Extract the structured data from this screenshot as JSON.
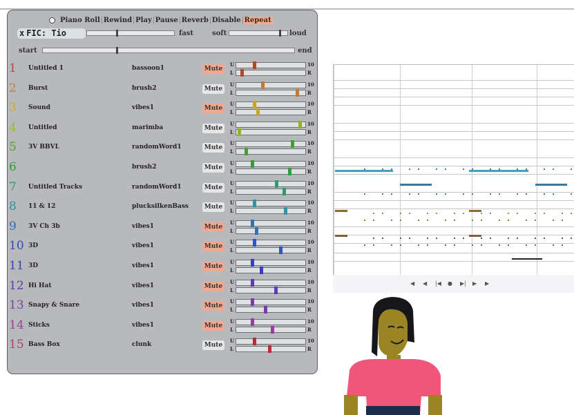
{
  "toolbar": {
    "items": [
      "Piano Roll",
      "Rewind",
      "Play",
      "Pause",
      "Reverb",
      "Disable",
      "Repeat"
    ]
  },
  "header": {
    "title_mark": "x",
    "title": "FIC: Tio",
    "fast_label": "fast",
    "soft_label": "soft",
    "loud_label": "loud",
    "start_label": "start",
    "end_label": "end"
  },
  "tracks": [
    {
      "num": "1",
      "num_color": "#b8482f",
      "name": "Untitled 1",
      "instrument": "bassoon1",
      "mute": "Mute",
      "mute_on": true,
      "volume": 0.25,
      "pan": 0.06,
      "color": "#b0472c"
    },
    {
      "num": "2",
      "num_color": "#c2813a",
      "name": "Burst",
      "instrument": "brush2",
      "mute": "Mute",
      "mute_on": false,
      "volume": 0.38,
      "pan": 0.9,
      "color": "#c6772d"
    },
    {
      "num": "3",
      "num_color": "#c8aa2a",
      "name": "Sound",
      "instrument": "vibes1",
      "mute": "Mute",
      "mute_on": true,
      "volume": 0.25,
      "pan": 0.3,
      "color": "#c5a81e"
    },
    {
      "num": "4",
      "num_color": "#9fb92d",
      "name": "Untitled",
      "instrument": "marimba",
      "mute": "Mute",
      "mute_on": false,
      "volume": 0.94,
      "pan": 0.02,
      "color": "#8eb426"
    },
    {
      "num": "5",
      "num_color": "#4fa12e",
      "name": "3V BBVL",
      "instrument": "randomWord1",
      "mute": "Mute",
      "mute_on": false,
      "volume": 0.82,
      "pan": 0.12,
      "color": "#3fa22a"
    },
    {
      "num": "6",
      "num_color": "#2f9f3a",
      "name": "",
      "instrument": "brush2",
      "mute": "Mute",
      "mute_on": false,
      "volume": 0.22,
      "pan": 0.78,
      "color": "#2fa13b"
    },
    {
      "num": "7",
      "num_color": "#2f9f6b",
      "name": "Untitled Tracks",
      "instrument": "randomWord1",
      "mute": "Mute",
      "mute_on": false,
      "volume": 0.58,
      "pan": 0.7,
      "color": "#2b9c6b"
    },
    {
      "num": "8",
      "num_color": "#2f8fa2",
      "name": "11 & 12",
      "instrument": "plucksilkenBass",
      "mute": "Mute",
      "mute_on": false,
      "volume": 0.25,
      "pan": 0.72,
      "color": "#2f95a4"
    },
    {
      "num": "9",
      "num_color": "#2f6fb3",
      "name": "3V Ch 3b",
      "instrument": "vibes1",
      "mute": "Mute",
      "mute_on": true,
      "volume": 0.22,
      "pan": 0.28,
      "color": "#2e74bb"
    },
    {
      "num": "10",
      "num_color": "#2d4fb1",
      "name": "3D",
      "instrument": "vibes1",
      "mute": "Mute",
      "mute_on": true,
      "volume": 0.25,
      "pan": 0.65,
      "color": "#2f55c0"
    },
    {
      "num": "11",
      "num_color": "#3a3fb0",
      "name": "3D",
      "instrument": "vibes1",
      "mute": "Mute",
      "mute_on": true,
      "volume": 0.22,
      "pan": 0.35,
      "color": "#3a3fc0"
    },
    {
      "num": "12",
      "num_color": "#5b3eb0",
      "name": "Hi Hat",
      "instrument": "vibes1",
      "mute": "Mute",
      "mute_on": true,
      "volume": 0.22,
      "pan": 0.57,
      "color": "#5a3eb8"
    },
    {
      "num": "13",
      "num_color": "#7a3fb0",
      "name": "Snapy & Snare",
      "instrument": "vibes1",
      "mute": "Mute",
      "mute_on": true,
      "volume": 0.22,
      "pan": 0.42,
      "color": "#7a3ab5"
    },
    {
      "num": "14",
      "num_color": "#9c3f9f",
      "name": "Sticks",
      "instrument": "vibes1",
      "mute": "Mute",
      "mute_on": true,
      "volume": 0.22,
      "pan": 0.52,
      "color": "#9a3a9c"
    },
    {
      "num": "15",
      "num_color": "#b13f5e",
      "name": "Bass Box",
      "instrument": "clunk",
      "mute": "Mute",
      "mute_on": false,
      "volume": 0.25,
      "pan": 0.48,
      "color": "#b52f3a"
    }
  ],
  "mixer_labels": {
    "u": "U",
    "l": "L",
    "top": "10",
    "bottom": "R"
  },
  "player": {
    "buttons": [
      "◀",
      "◀",
      "|◀",
      "●",
      "▶|",
      "▶",
      "▶"
    ]
  }
}
